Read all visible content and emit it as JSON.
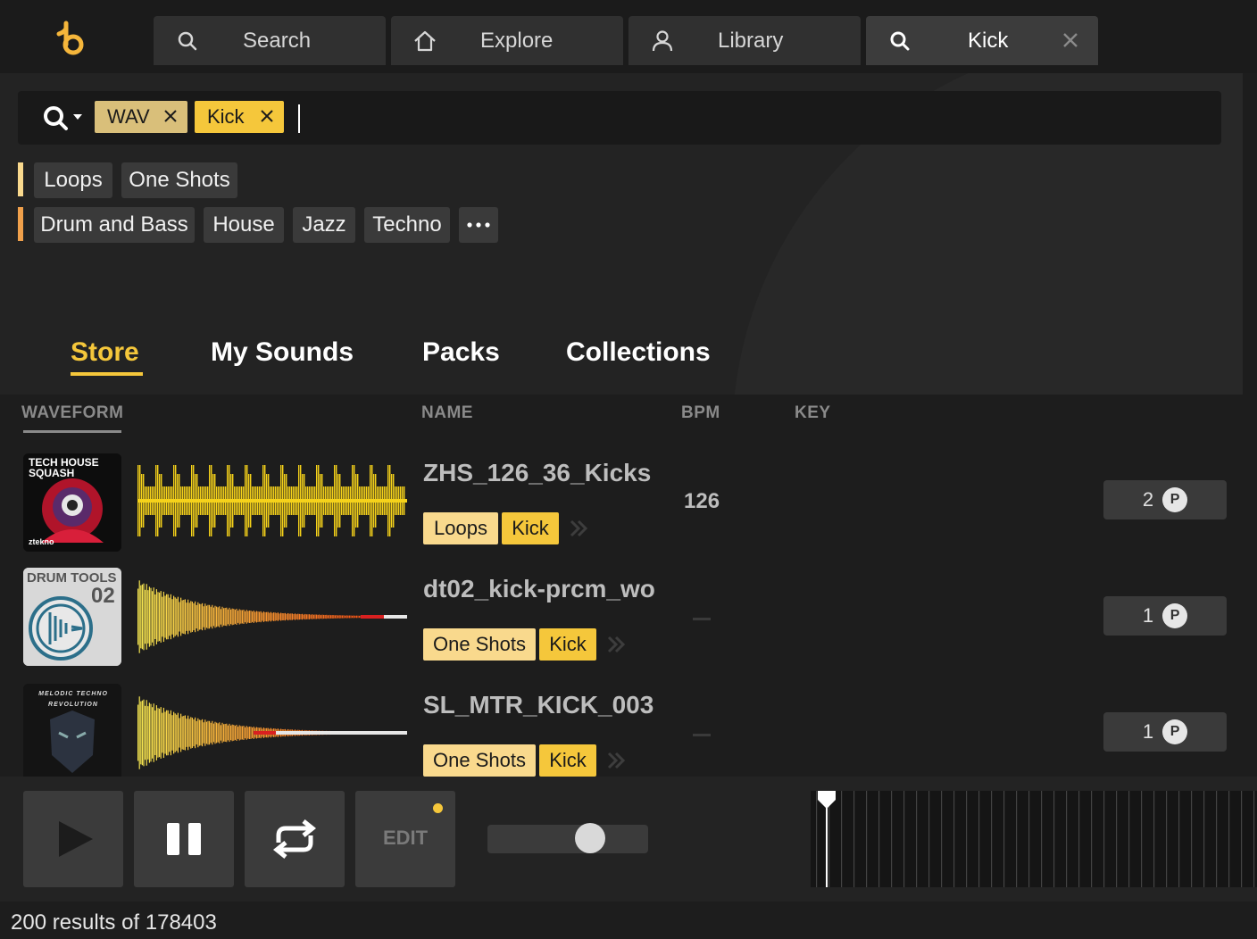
{
  "nav": {
    "tabs": [
      {
        "label": "Search",
        "icon": "search-icon"
      },
      {
        "label": "Explore",
        "icon": "home-icon"
      },
      {
        "label": "Library",
        "icon": "user-icon"
      },
      {
        "label": "Kick",
        "icon": "search-icon",
        "active": true,
        "closable": true
      }
    ]
  },
  "search": {
    "chips": [
      {
        "label": "WAV",
        "color": "#d9bf7a"
      },
      {
        "label": "Kick",
        "color": "#f5c73b"
      }
    ]
  },
  "filters": {
    "type_row": [
      "Loops",
      "One Shots"
    ],
    "genre_row": [
      "Drum and Bass",
      "House",
      "Jazz",
      "Techno"
    ],
    "more_label": "···",
    "type_color": "#f9d98d",
    "genre_color": "#f0a04b"
  },
  "sections": {
    "tabs": [
      "Store",
      "My Sounds",
      "Packs",
      "Collections"
    ],
    "active": "Store"
  },
  "table": {
    "headers": {
      "waveform": "WAVEFORM",
      "name": "NAME",
      "bpm": "BPM",
      "key": "KEY"
    },
    "rows": [
      {
        "name": "ZHS_126_36_Kicks",
        "bpm": "126",
        "tags": [
          "Loops",
          "Kick"
        ],
        "count": "2",
        "points_badge": "P",
        "cover_text": "TECH HOUSE SQUASH",
        "cover_brand": "ztekno"
      },
      {
        "name": "dt02_kick-prcm_wo",
        "bpm": "",
        "tags": [
          "One Shots",
          "Kick"
        ],
        "count": "1",
        "points_badge": "P",
        "cover_text": "DRUM TOOLS",
        "cover_num": "02"
      },
      {
        "name": "SL_MTR_KICK_003",
        "bpm": "",
        "tags": [
          "One Shots",
          "Kick"
        ],
        "count": "1",
        "points_badge": "P",
        "cover_text": "MELODIC TECHNO REVOLUTION"
      }
    ]
  },
  "player": {
    "edit_label": "EDIT",
    "volume": 0.67
  },
  "status": "200 results of 178403"
}
